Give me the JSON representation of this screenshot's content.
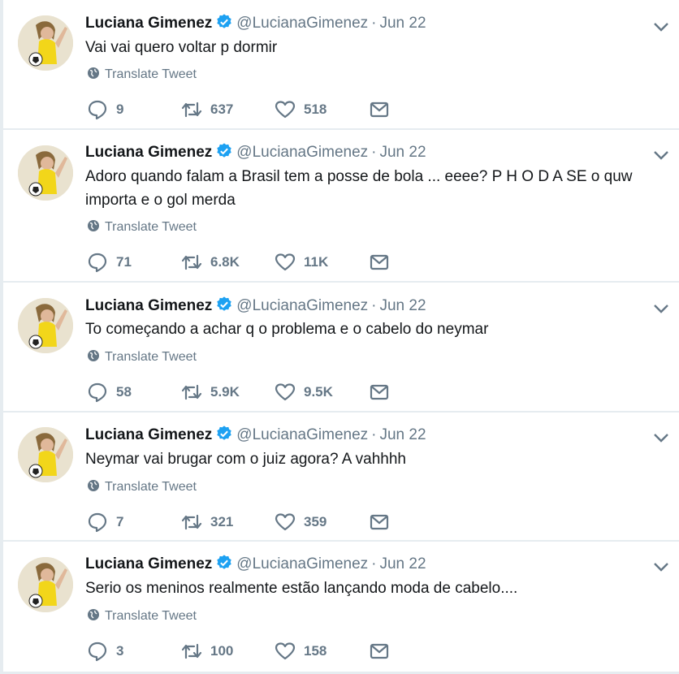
{
  "colors": {
    "text": "#14171a",
    "muted": "#657786",
    "verified": "#1da1f2",
    "bg": "#e6ecf0"
  },
  "icons": {
    "reply": "reply-icon",
    "retweet": "retweet-icon",
    "like": "heart-icon",
    "dm": "envelope-icon",
    "menu": "chevron-down-icon",
    "translate": "globe-icon",
    "verified": "verified-badge-icon"
  },
  "tweets": [
    {
      "name": "Luciana Gimenez",
      "handle": "@LucianaGimenez",
      "separator": "·",
      "date": "Jun 22",
      "text": "Vai vai quero voltar p dormir",
      "translate": "Translate Tweet",
      "replies": "9",
      "retweets": "637",
      "likes": "518"
    },
    {
      "name": "Luciana Gimenez",
      "handle": "@LucianaGimenez",
      "separator": "·",
      "date": "Jun 22",
      "text": "Adoro quando falam a Brasil tem a posse de bola ... eeee? P H O D A SE  o quw importa e o gol merda",
      "translate": "Translate Tweet",
      "replies": "71",
      "retweets": "6.8K",
      "likes": "11K"
    },
    {
      "name": "Luciana Gimenez",
      "handle": "@LucianaGimenez",
      "separator": "·",
      "date": "Jun 22",
      "text": "To começando a achar q o problema e o cabelo do neymar",
      "translate": "Translate Tweet",
      "replies": "58",
      "retweets": "5.9K",
      "likes": "9.5K"
    },
    {
      "name": "Luciana Gimenez",
      "handle": "@LucianaGimenez",
      "separator": "·",
      "date": "Jun 22",
      "text": "Neymar vai brugar com o juiz agora? A vahhhh",
      "translate": "Translate Tweet",
      "replies": "7",
      "retweets": "321",
      "likes": "359"
    },
    {
      "name": "Luciana Gimenez",
      "handle": "@LucianaGimenez",
      "separator": "·",
      "date": "Jun 22",
      "text": "Serio os meninos realmente estão lançando moda de cabelo....",
      "translate": "Translate Tweet",
      "replies": "3",
      "retweets": "100",
      "likes": "158"
    }
  ]
}
